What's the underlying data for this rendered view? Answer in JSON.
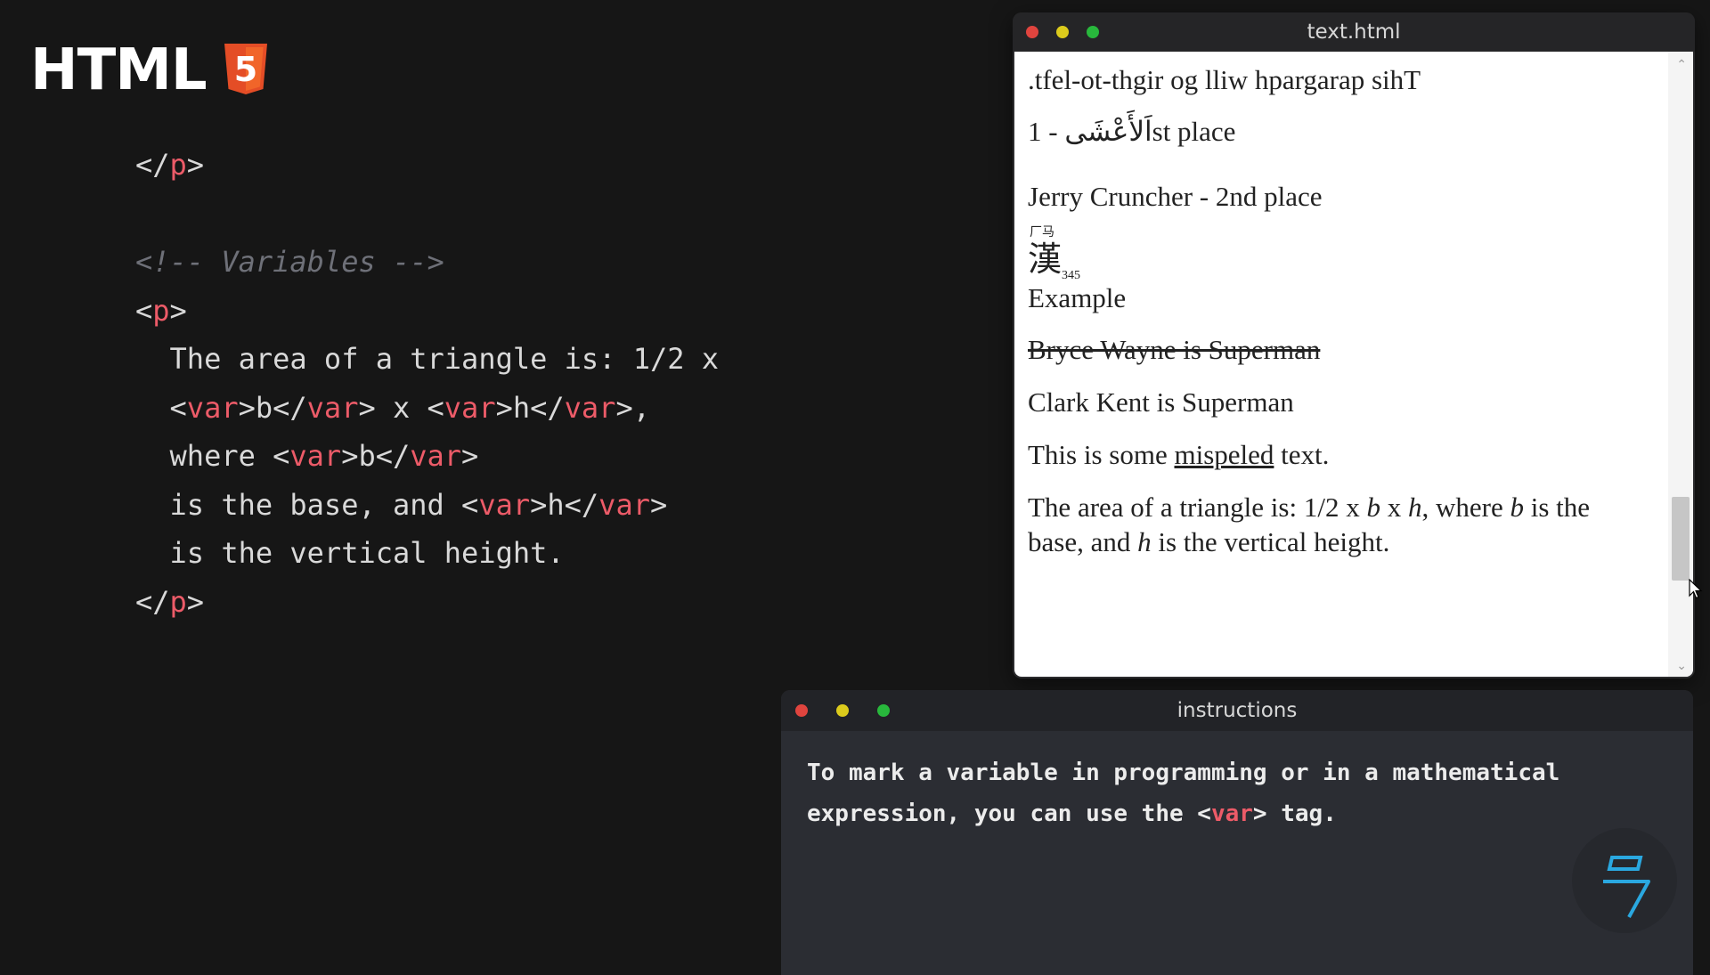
{
  "logo": {
    "text": "HTML",
    "badge_number": "5",
    "badge_color": "#e44d26"
  },
  "code_lines": [
    [
      {
        "t": "</",
        "c": "tag"
      },
      {
        "t": "p",
        "c": "tn"
      },
      {
        "t": ">",
        "c": "tag"
      }
    ],
    [],
    [
      {
        "t": "<!-- Variables -->",
        "c": "cm"
      }
    ],
    [
      {
        "t": "<",
        "c": "tag"
      },
      {
        "t": "p",
        "c": "tn"
      },
      {
        "t": ">",
        "c": "tag"
      }
    ],
    [
      {
        "t": "  The area of a triangle is: 1/2 x",
        "c": "tag"
      }
    ],
    [
      {
        "t": "  <",
        "c": "tag"
      },
      {
        "t": "var",
        "c": "tn"
      },
      {
        "t": ">b</",
        "c": "tag"
      },
      {
        "t": "var",
        "c": "tn"
      },
      {
        "t": "> x <",
        "c": "tag"
      },
      {
        "t": "var",
        "c": "tn"
      },
      {
        "t": ">h</",
        "c": "tag"
      },
      {
        "t": "var",
        "c": "tn"
      },
      {
        "t": ">,",
        "c": "tag"
      }
    ],
    [
      {
        "t": "  where <",
        "c": "tag"
      },
      {
        "t": "var",
        "c": "tn"
      },
      {
        "t": ">b</",
        "c": "tag"
      },
      {
        "t": "var",
        "c": "tn"
      },
      {
        "t": ">",
        "c": "tag"
      }
    ],
    [
      {
        "t": "  is the base, and <",
        "c": "tag"
      },
      {
        "t": "var",
        "c": "tn"
      },
      {
        "t": ">h</",
        "c": "tag"
      },
      {
        "t": "var",
        "c": "tn"
      },
      {
        "t": ">",
        "c": "tag"
      }
    ],
    [
      {
        "t": "  is the vertical height.",
        "c": "tag"
      }
    ],
    [
      {
        "t": "</",
        "c": "tag"
      },
      {
        "t": "p",
        "c": "tn"
      },
      {
        "t": ">",
        "c": "tag"
      }
    ]
  ],
  "browser": {
    "title": "text.html",
    "reversed_text": ".tfel-ot-thgir og lliw hpargarap sihT",
    "arabic_name": "اَلأَعْشَى",
    "arabic_suffix": " - 1st place",
    "second_place": "Jerry Cruncher - 2nd place",
    "ruby_base": "漢",
    "ruby_annotation": "厂马",
    "sub_number": "345",
    "example": "Example",
    "strike_text": "Bryce Wayne is Superman",
    "inserted_text": "Clark Kent is Superman",
    "misspell_prefix": "This is some ",
    "misspell_word": "mispeled",
    "misspell_suffix": " text.",
    "triangle_line1_a": "The area of a triangle is: 1/2 x ",
    "var_b": "b",
    "times": " x ",
    "var_h": "h",
    "triangle_line1_b": ", where ",
    "triangle_line1_c": " is the",
    "triangle_line2_a": "base, and ",
    "triangle_line2_b": " is the vertical height.",
    "scroll_position": 0.85
  },
  "instructions": {
    "title": "instructions",
    "line1": "To mark a variable in programming or in a mathematical",
    "line2_a": "expression, you can use the <",
    "line2_tag": "var",
    "line2_b": "> tag."
  },
  "colors": {
    "background": "#161616",
    "tag_name": "#ec5b68",
    "comment": "#6e7078",
    "brand_accent": "#2aa8e0"
  }
}
